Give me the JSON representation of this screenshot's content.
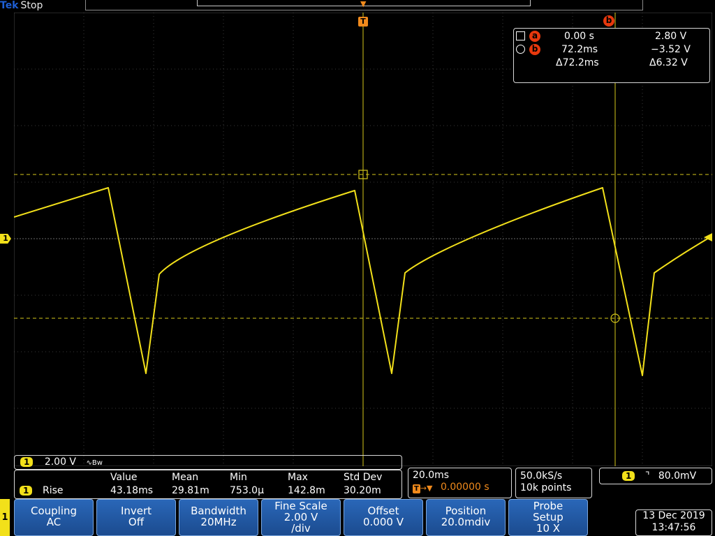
{
  "status": {
    "brand": "Tek",
    "state": "Stop"
  },
  "colors": {
    "channel1": "#f2e01a",
    "cursor": "#e8380d",
    "softkey": "#2a67b8",
    "trigger_marker": "#f08a1c"
  },
  "icons": {
    "trigger_marker": "T-arrow-icon",
    "cursor_a": "square-cursor-icon",
    "cursor_b": "circle-cursor-icon",
    "edge": "falling-edge-icon"
  },
  "channel_marker": "1",
  "cursor_readout": {
    "header_badge": "b",
    "row_a": {
      "badge": "a",
      "time": "0.00 s",
      "voltage": "2.80 V"
    },
    "row_b": {
      "badge": "b",
      "time": "72.2ms",
      "voltage": "−3.52 V"
    },
    "delta": {
      "time": "Δ72.2ms",
      "voltage": "Δ6.32 V"
    }
  },
  "channel_scale": {
    "channel": "1",
    "scale": "2.00 V",
    "bandwidth_symbol": "∿Bw"
  },
  "measurement": {
    "channel": "1",
    "name": "Rise",
    "headers": [
      "Value",
      "Mean",
      "Min",
      "Max",
      "Std Dev"
    ],
    "values": [
      "43.18ms",
      "29.81m",
      "753.0µ",
      "142.8m",
      "30.20m"
    ]
  },
  "timebase": {
    "scale": "20.0ms",
    "trigger_position": "0.00000 s"
  },
  "acquisition": {
    "sample_rate": "50.0kS/s",
    "record_length": "10k points"
  },
  "trigger": {
    "channel": "1",
    "level": "80.0mV"
  },
  "softkeys": {
    "channel": "1",
    "items": [
      {
        "l1": "Coupling",
        "l2": "AC"
      },
      {
        "l1": "Invert",
        "l2": "Off"
      },
      {
        "l1": "Bandwidth",
        "l2": "20MHz"
      },
      {
        "l1": "Fine Scale",
        "l2": "2.00 V",
        "l3": "/div"
      },
      {
        "l1": "Offset",
        "l2": "0.000 V"
      },
      {
        "l1": "Position",
        "l2": "20.0mdiv"
      },
      {
        "l1": "Probe",
        "l2": "Setup",
        "l3": "10 X"
      }
    ]
  },
  "datetime": {
    "date": "13 Dec 2019",
    "time": "13:47:56"
  }
}
